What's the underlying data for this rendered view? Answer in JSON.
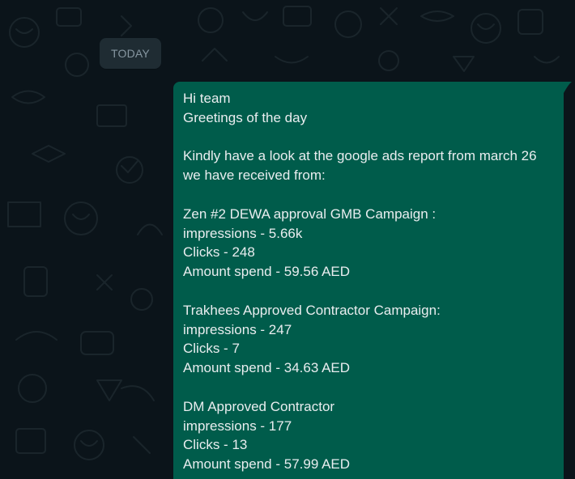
{
  "chat": {
    "date_divider": "TODAY",
    "colors": {
      "background": "#0b141a",
      "outgoing_bubble": "#005c4b",
      "text": "#e9edef",
      "chip": "#1f2c33"
    },
    "message": {
      "lines": [
        "Hi team",
        "Greetings of the day",
        "",
        "Kindly have a look at the google ads report from march 26",
        "we have received from:",
        "",
        "Zen #2 DEWA approval GMB Campaign :",
        "impressions - 5.66k",
        "Clicks - 248",
        "Amount spend - 59.56 AED",
        "",
        "Trakhees Approved Contractor Campaign:",
        "impressions - 247",
        "Clicks - 7",
        "Amount spend - 34.63 AED",
        "",
        "DM Approved Contractor",
        "impressions - 177",
        "Clicks - 13",
        "Amount spend - 57.99 AED"
      ]
    }
  }
}
